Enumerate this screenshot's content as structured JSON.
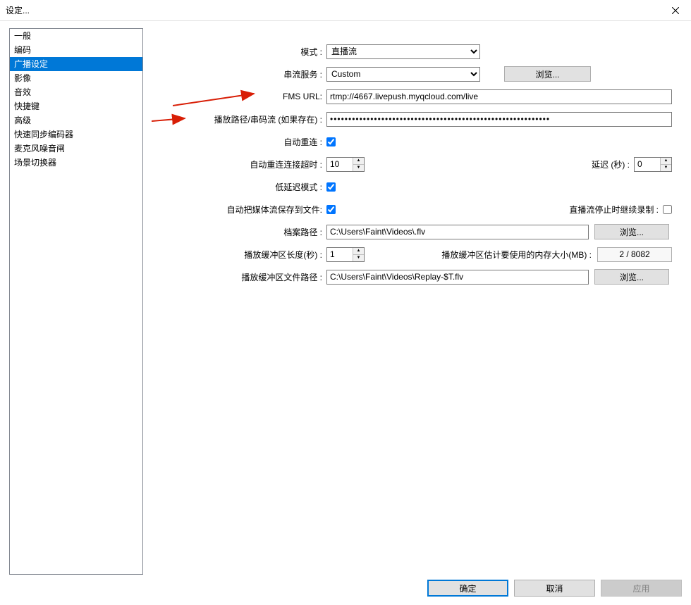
{
  "window": {
    "title": "设定..."
  },
  "sidebar": {
    "items": [
      {
        "label": "一般"
      },
      {
        "label": "编码"
      },
      {
        "label": "广播设定",
        "selected": true
      },
      {
        "label": "影像"
      },
      {
        "label": "音效"
      },
      {
        "label": "快捷键"
      },
      {
        "label": "高级"
      },
      {
        "label": "快速同步编码器"
      },
      {
        "label": "麦克风噪音闸"
      },
      {
        "label": "场景切换器"
      }
    ]
  },
  "labels": {
    "mode": "模式 :",
    "service": "串流服务 :",
    "fms": "FMS URL:",
    "playpath": "播放路径/串码流 (如果存在) :",
    "autoreconnect": "自动重连 :",
    "reconnecttimeout": "自动重连连接超时 :",
    "delay": "延迟 (秒) :",
    "lowlatency": "低延迟模式 :",
    "savefile": "自动把媒体流保存到文件:",
    "keeprecording": "直播流停止时继续录制 :",
    "filepath": "档案路径 :",
    "bufferlen": "播放缓冲区长度(秒) :",
    "memest": "播放缓冲区估计要使用的内存大小(MB) :",
    "bufferpath": "播放缓冲区文件路径 :"
  },
  "values": {
    "mode": "直播流",
    "service": "Custom",
    "fms_url": "rtmp://4667.livepush.myqcloud.com/live",
    "playpath": "●●●●●●●●●●●●●●●●●●●●●●●●●●●●●●●●●●●●●●●●●●●●●●●●●●●●●●●●●●●●",
    "autoreconnect": true,
    "reconnect_timeout": "10",
    "delay": "0",
    "lowlatency": true,
    "savefile": true,
    "keeprecording": false,
    "filepath": "C:\\Users\\Faint\\Videos\\.flv",
    "bufferlen": "1",
    "memest": "2 / 8082",
    "bufferpath": "C:\\Users\\Faint\\Videos\\Replay-$T.flv"
  },
  "buttons": {
    "browse": "浏览...",
    "browse2": "浏览...",
    "browse3": "浏览...",
    "ok": "确定",
    "cancel": "取消",
    "apply": "应用"
  }
}
